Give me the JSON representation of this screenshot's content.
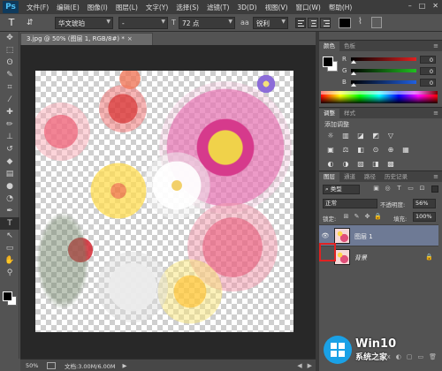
{
  "app": {
    "logo": "Ps",
    "menu": [
      "文件(F)",
      "编辑(E)",
      "图像(I)",
      "图层(L)",
      "文字(Y)",
      "选择(S)",
      "滤镜(T)",
      "3D(D)",
      "视图(V)",
      "窗口(W)",
      "帮助(H)"
    ],
    "window_controls": [
      "–",
      "□",
      "✕"
    ]
  },
  "options_bar": {
    "tool_icon": "T",
    "orientation_icon": "⇵",
    "font_family": "华文琥珀",
    "font_style": "-",
    "size_icon": "T",
    "font_size": "72 点",
    "aa_icon": "aa",
    "anti_alias": "锐利",
    "text_color": "#000000"
  },
  "document": {
    "tab_title": "3.jpg @ 50% (图层 1, RGB/8#) *",
    "tab_close": "×"
  },
  "toolbar": {
    "tools": [
      "move-tool",
      "marquee-tool",
      "lasso-tool",
      "quick-select-tool",
      "crop-tool",
      "eyedropper-tool",
      "healing-tool",
      "brush-tool",
      "clone-stamp-tool",
      "history-brush-tool",
      "eraser-tool",
      "gradient-tool",
      "blur-tool",
      "dodge-tool",
      "pen-tool",
      "type-tool",
      "path-select-tool",
      "shape-tool",
      "hand-tool",
      "zoom-tool"
    ],
    "glyphs": [
      "✥",
      "⬚",
      "ʘ",
      "✎",
      "⌗",
      "⁄",
      "✚",
      "✏",
      "⊥",
      "↺",
      "◆",
      "▤",
      "●",
      "◔",
      "✒",
      "T",
      "↖",
      "▭",
      "✋",
      "⚲"
    ],
    "active_index": 15
  },
  "status_bar": {
    "zoom": "50%",
    "doc_info": "文档:3.00M/6.00M",
    "arrow": "▶"
  },
  "color_panel": {
    "tabs": [
      "颜色",
      "色板"
    ],
    "channels": [
      {
        "label": "R",
        "value": "0",
        "color": "#e02020"
      },
      {
        "label": "G",
        "value": "0",
        "color": "#20c020"
      },
      {
        "label": "B",
        "value": "0",
        "color": "#2060e0"
      }
    ]
  },
  "adjust_panel": {
    "tabs": [
      "调整",
      "样式"
    ],
    "title": "添加调整",
    "icons": [
      "☼",
      "▥",
      "◪",
      "◩",
      "▽",
      "",
      "▣",
      "⚖",
      "◧",
      "⊙",
      "⊕",
      "▦",
      "◐",
      "◑",
      "▨",
      "◨",
      "▩",
      ""
    ]
  },
  "layers_panel": {
    "tabs": [
      "图层",
      "通道",
      "路径",
      "历史记录"
    ],
    "kind": "类型",
    "filter_icons": [
      "▣",
      "◎",
      "T",
      "▭",
      "⊡"
    ],
    "blend_mode": "正常",
    "opacity_label": "不透明度:",
    "opacity": "56%",
    "lock_label": "锁定:",
    "lock_icons": [
      "⊞",
      "✎",
      "✥",
      "🔒"
    ],
    "fill_label": "填充:",
    "fill": "100%",
    "layers": [
      {
        "name": "图层 1",
        "visible": true,
        "selected": true,
        "locked": false
      },
      {
        "name": "背景",
        "visible": false,
        "selected": false,
        "locked": true
      }
    ],
    "bottom_icons": [
      "⊖",
      "fx",
      "◐",
      "▢",
      "▭",
      "🗑"
    ],
    "eye_icon": "👁",
    "lock_icon": "🔒"
  },
  "watermark": {
    "title": "Win10",
    "subtitle": "系统之家"
  }
}
